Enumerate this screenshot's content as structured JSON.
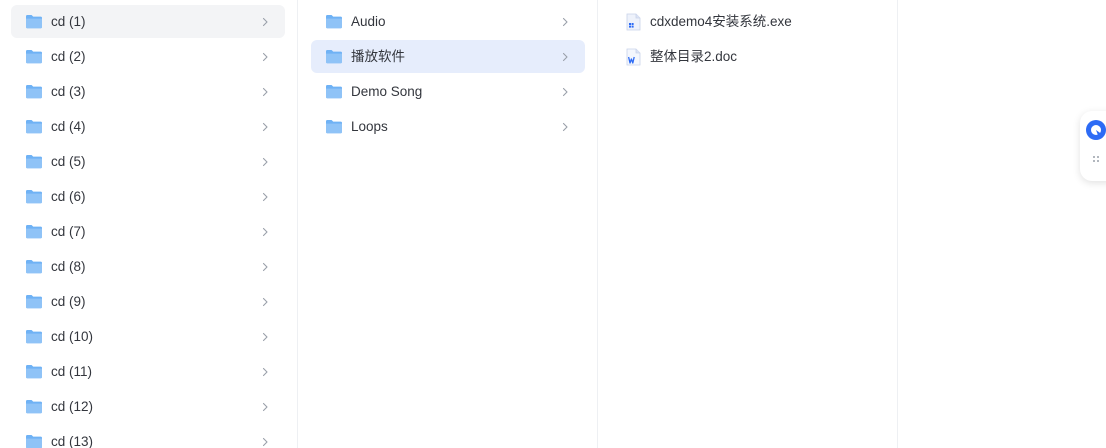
{
  "columns": [
    {
      "items": [
        {
          "name": "cd (1)",
          "type": "folder",
          "state": "hover"
        },
        {
          "name": "cd (2)",
          "type": "folder"
        },
        {
          "name": "cd (3)",
          "type": "folder"
        },
        {
          "name": "cd (4)",
          "type": "folder"
        },
        {
          "name": "cd (5)",
          "type": "folder"
        },
        {
          "name": "cd (6)",
          "type": "folder"
        },
        {
          "name": "cd (7)",
          "type": "folder"
        },
        {
          "name": "cd (8)",
          "type": "folder"
        },
        {
          "name": "cd (9)",
          "type": "folder"
        },
        {
          "name": "cd (10)",
          "type": "folder"
        },
        {
          "name": "cd (11)",
          "type": "folder"
        },
        {
          "name": "cd (12)",
          "type": "folder"
        },
        {
          "name": "cd (13)",
          "type": "folder"
        }
      ]
    },
    {
      "items": [
        {
          "name": "Audio",
          "type": "folder"
        },
        {
          "name": "播放软件",
          "type": "folder",
          "state": "selected"
        },
        {
          "name": "Demo Song",
          "type": "folder"
        },
        {
          "name": "Loops",
          "type": "folder"
        }
      ]
    },
    {
      "items": [
        {
          "name": "cdxdemo4安装系统.exe",
          "type": "exe"
        },
        {
          "name": "整体目录2.doc",
          "type": "doc"
        }
      ]
    }
  ],
  "icons": {
    "folder": "folder-icon",
    "exe": "exe-file-icon",
    "doc": "word-doc-icon",
    "chevron": "chevron-right-icon",
    "widget": "assistant-logo-icon",
    "grip": "drag-grip-icon"
  },
  "colors": {
    "folder": "#6fb2f5",
    "selected_bg": "#e6edfc",
    "hover_bg": "#f3f4f6",
    "accent": "#2d6bf5"
  }
}
